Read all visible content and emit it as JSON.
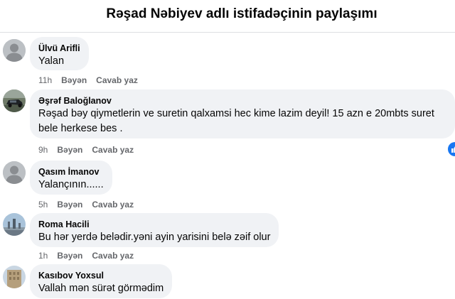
{
  "header": {
    "title": "Rəşad Nəbiyev adlı istifadəçinin paylaşımı"
  },
  "comments": [
    {
      "author": "Ülvü Arifli",
      "text": "Yalan",
      "time": "11h",
      "like": "Bəyən",
      "reply": "Cavab yaz",
      "avatar": "default"
    },
    {
      "author": "Əşrəf Baloğlanov",
      "text1": "Rəşad bəy qiymetlerin ve suretin qalxamsi hec kime lazim deyil! 15 azn e 20mbts suret",
      "text2": "bele herkese bes .",
      "time": "9h",
      "like": "Bəyən",
      "reply": "Cavab yaz",
      "avatar": "car-photo",
      "reaction": "like-icon"
    },
    {
      "author": "Qasım İmanov",
      "text": "Yalançının......",
      "time": "5h",
      "like": "Bəyən",
      "reply": "Cavab yaz",
      "avatar": "default"
    },
    {
      "author": "Roma Hacili",
      "text": "Bu hər yerdə belədir.yəni ayin yarisini belə zəif olur",
      "time": "1h",
      "like": "Bəyən",
      "reply": "Cavab yaz",
      "avatar": "city-photo"
    },
    {
      "author": "Kasıbov Yoxsul",
      "text": "Vallah mən sürət görmədim",
      "avatar": "building-photo"
    }
  ]
}
